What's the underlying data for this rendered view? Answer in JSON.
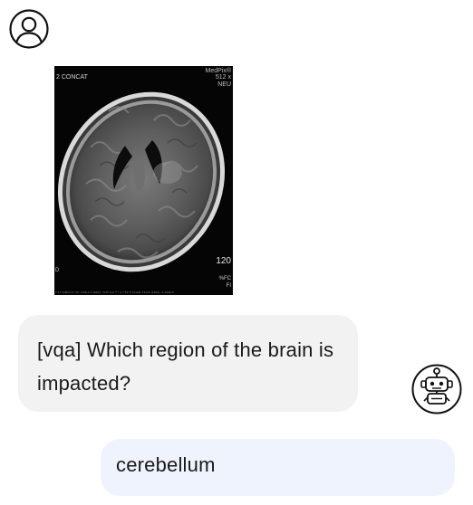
{
  "chat": {
    "user_avatar_icon": "user-avatar-icon",
    "bot_avatar_icon": "robot-icon",
    "mri": {
      "sequence_label": "2 CONCAT",
      "brand_label": "MedPix®",
      "size_label": "512  x",
      "dept_label": "NEU",
      "number_label": "120",
      "fc_label": "%FC",
      "fi_label": "FI",
      "left_mark": "D",
      "footer_label": "7:17 NiBCrL7: ID: 4:50-0 7:2M&7; 7x0*:4:2 ***-1.7:51*1 FLAIR-TF/23 (1200); 4:1500-5"
    },
    "question": "[vqa] Which region of the brain is impacted?",
    "answer": "cerebellum"
  }
}
